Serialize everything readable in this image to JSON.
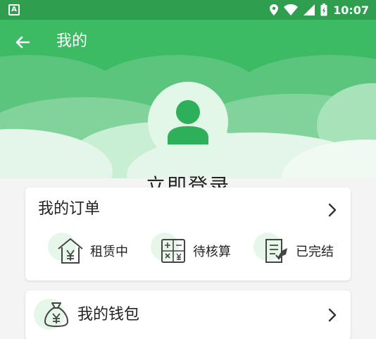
{
  "status_bar": {
    "time": "10:07",
    "left_icon": "a-notification-icon",
    "icons": [
      "location-icon",
      "wifi-icon",
      "signal-icon",
      "battery-icon"
    ]
  },
  "header": {
    "title": "我的",
    "back_icon": "back-arrow-icon",
    "login_label": "立即登录",
    "avatar_icon": "user-avatar-icon"
  },
  "orders": {
    "title": "我的订单",
    "items": [
      {
        "label": "租赁中",
        "icon": "house-yen-icon"
      },
      {
        "label": "待核算",
        "icon": "calculator-icon"
      },
      {
        "label": "已完结",
        "icon": "document-check-icon"
      }
    ]
  },
  "wallet": {
    "title": "我的钱包",
    "icon": "money-bag-icon"
  },
  "colors": {
    "primary": "#3cbb64",
    "status_bar": "#2f9e4e",
    "icon_bg": "#e6f7ea",
    "background": "#f4f4f4"
  }
}
